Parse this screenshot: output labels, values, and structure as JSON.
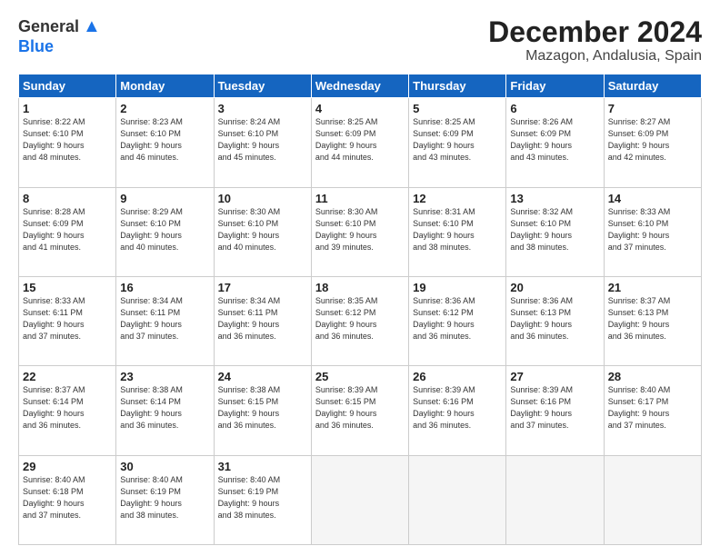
{
  "header": {
    "logo_general": "General",
    "logo_blue": "Blue",
    "title": "December 2024",
    "subtitle": "Mazagon, Andalusia, Spain"
  },
  "calendar": {
    "days_of_week": [
      "Sunday",
      "Monday",
      "Tuesday",
      "Wednesday",
      "Thursday",
      "Friday",
      "Saturday"
    ],
    "weeks": [
      [
        {
          "day": "",
          "empty": true
        },
        {
          "day": "",
          "empty": true
        },
        {
          "day": "",
          "empty": true
        },
        {
          "day": "",
          "empty": true
        },
        {
          "day": "",
          "empty": true
        },
        {
          "day": "",
          "empty": true
        },
        {
          "day": "",
          "empty": true
        }
      ],
      [
        {
          "day": "1",
          "info": "Sunrise: 8:22 AM\nSunset: 6:10 PM\nDaylight: 9 hours\nand 48 minutes."
        },
        {
          "day": "2",
          "info": "Sunrise: 8:23 AM\nSunset: 6:10 PM\nDaylight: 9 hours\nand 46 minutes."
        },
        {
          "day": "3",
          "info": "Sunrise: 8:24 AM\nSunset: 6:10 PM\nDaylight: 9 hours\nand 45 minutes."
        },
        {
          "day": "4",
          "info": "Sunrise: 8:25 AM\nSunset: 6:09 PM\nDaylight: 9 hours\nand 44 minutes."
        },
        {
          "day": "5",
          "info": "Sunrise: 8:25 AM\nSunset: 6:09 PM\nDaylight: 9 hours\nand 43 minutes."
        },
        {
          "day": "6",
          "info": "Sunrise: 8:26 AM\nSunset: 6:09 PM\nDaylight: 9 hours\nand 43 minutes."
        },
        {
          "day": "7",
          "info": "Sunrise: 8:27 AM\nSunset: 6:09 PM\nDaylight: 9 hours\nand 42 minutes."
        }
      ],
      [
        {
          "day": "8",
          "info": "Sunrise: 8:28 AM\nSunset: 6:09 PM\nDaylight: 9 hours\nand 41 minutes."
        },
        {
          "day": "9",
          "info": "Sunrise: 8:29 AM\nSunset: 6:10 PM\nDaylight: 9 hours\nand 40 minutes."
        },
        {
          "day": "10",
          "info": "Sunrise: 8:30 AM\nSunset: 6:10 PM\nDaylight: 9 hours\nand 40 minutes."
        },
        {
          "day": "11",
          "info": "Sunrise: 8:30 AM\nSunset: 6:10 PM\nDaylight: 9 hours\nand 39 minutes."
        },
        {
          "day": "12",
          "info": "Sunrise: 8:31 AM\nSunset: 6:10 PM\nDaylight: 9 hours\nand 38 minutes."
        },
        {
          "day": "13",
          "info": "Sunrise: 8:32 AM\nSunset: 6:10 PM\nDaylight: 9 hours\nand 38 minutes."
        },
        {
          "day": "14",
          "info": "Sunrise: 8:33 AM\nSunset: 6:10 PM\nDaylight: 9 hours\nand 37 minutes."
        }
      ],
      [
        {
          "day": "15",
          "info": "Sunrise: 8:33 AM\nSunset: 6:11 PM\nDaylight: 9 hours\nand 37 minutes."
        },
        {
          "day": "16",
          "info": "Sunrise: 8:34 AM\nSunset: 6:11 PM\nDaylight: 9 hours\nand 37 minutes."
        },
        {
          "day": "17",
          "info": "Sunrise: 8:34 AM\nSunset: 6:11 PM\nDaylight: 9 hours\nand 36 minutes."
        },
        {
          "day": "18",
          "info": "Sunrise: 8:35 AM\nSunset: 6:12 PM\nDaylight: 9 hours\nand 36 minutes."
        },
        {
          "day": "19",
          "info": "Sunrise: 8:36 AM\nSunset: 6:12 PM\nDaylight: 9 hours\nand 36 minutes."
        },
        {
          "day": "20",
          "info": "Sunrise: 8:36 AM\nSunset: 6:13 PM\nDaylight: 9 hours\nand 36 minutes."
        },
        {
          "day": "21",
          "info": "Sunrise: 8:37 AM\nSunset: 6:13 PM\nDaylight: 9 hours\nand 36 minutes."
        }
      ],
      [
        {
          "day": "22",
          "info": "Sunrise: 8:37 AM\nSunset: 6:14 PM\nDaylight: 9 hours\nand 36 minutes."
        },
        {
          "day": "23",
          "info": "Sunrise: 8:38 AM\nSunset: 6:14 PM\nDaylight: 9 hours\nand 36 minutes."
        },
        {
          "day": "24",
          "info": "Sunrise: 8:38 AM\nSunset: 6:15 PM\nDaylight: 9 hours\nand 36 minutes."
        },
        {
          "day": "25",
          "info": "Sunrise: 8:39 AM\nSunset: 6:15 PM\nDaylight: 9 hours\nand 36 minutes."
        },
        {
          "day": "26",
          "info": "Sunrise: 8:39 AM\nSunset: 6:16 PM\nDaylight: 9 hours\nand 36 minutes."
        },
        {
          "day": "27",
          "info": "Sunrise: 8:39 AM\nSunset: 6:16 PM\nDaylight: 9 hours\nand 37 minutes."
        },
        {
          "day": "28",
          "info": "Sunrise: 8:40 AM\nSunset: 6:17 PM\nDaylight: 9 hours\nand 37 minutes."
        }
      ],
      [
        {
          "day": "29",
          "info": "Sunrise: 8:40 AM\nSunset: 6:18 PM\nDaylight: 9 hours\nand 37 minutes."
        },
        {
          "day": "30",
          "info": "Sunrise: 8:40 AM\nSunset: 6:19 PM\nDaylight: 9 hours\nand 38 minutes."
        },
        {
          "day": "31",
          "info": "Sunrise: 8:40 AM\nSunset: 6:19 PM\nDaylight: 9 hours\nand 38 minutes."
        },
        {
          "day": "",
          "empty": true
        },
        {
          "day": "",
          "empty": true
        },
        {
          "day": "",
          "empty": true
        },
        {
          "day": "",
          "empty": true
        }
      ]
    ]
  }
}
